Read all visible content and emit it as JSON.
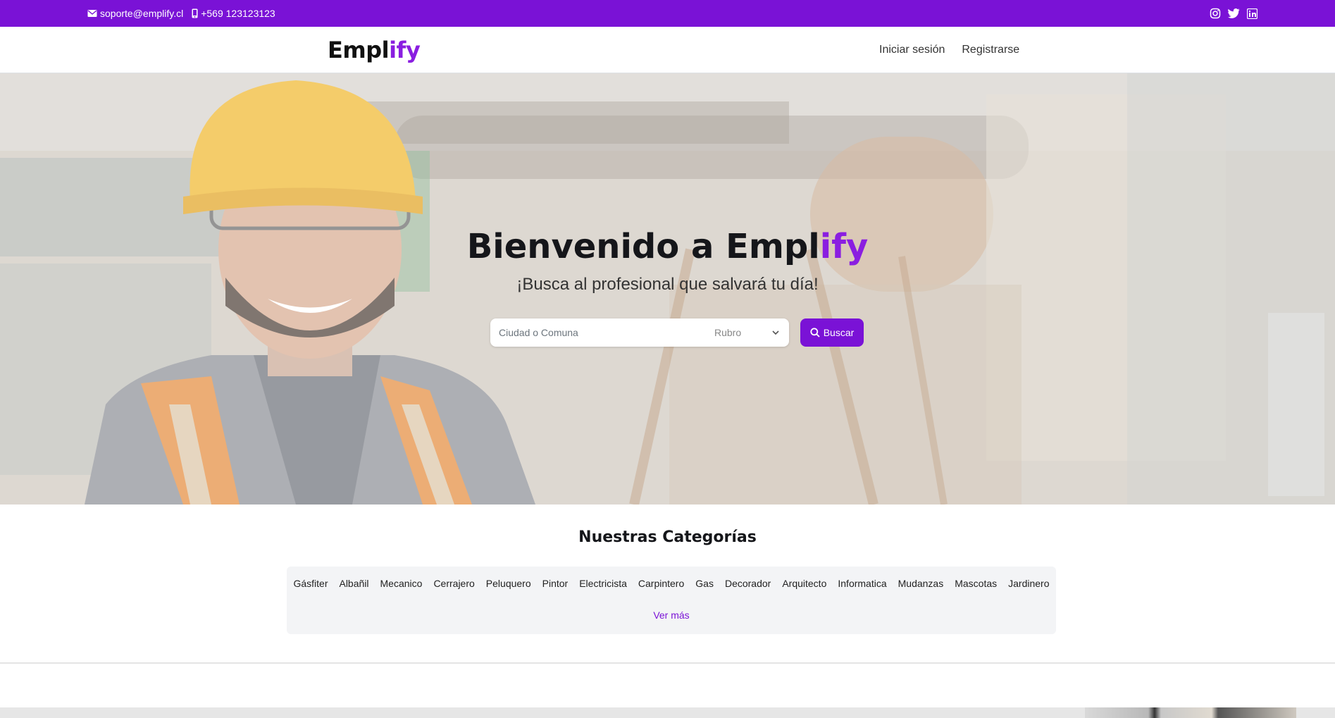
{
  "topbar": {
    "email": "soporte@emplify.cl",
    "phone": "+569 123123123",
    "social": [
      "instagram-icon",
      "twitter-icon",
      "linkedin-icon"
    ]
  },
  "brand": {
    "prefix": "Empl",
    "accent": "ify"
  },
  "nav": {
    "login": "Iniciar sesión",
    "register": "Registrarse"
  },
  "hero": {
    "title_prefix": "Bienvenido a Empl",
    "title_accent": "ify",
    "subtitle": "¡Busca al profesional que salvará tu día!",
    "search_placeholder": "Ciudad o Comuna",
    "select_value": "Rubro",
    "search_button": "Buscar"
  },
  "categories": {
    "title": "Nuestras Categorías",
    "items": [
      "Gásfiter",
      "Albañil",
      "Mecanico",
      "Cerrajero",
      "Peluquero",
      "Pintor",
      "Electricista",
      "Carpintero",
      "Gas",
      "Decorador",
      "Arquitecto",
      "Informatica",
      "Mudanzas",
      "Mascotas",
      "Jardinero"
    ],
    "more": "Ver más"
  },
  "colors": {
    "brand": "#7a12d6",
    "accent": "#8a1ee0"
  }
}
